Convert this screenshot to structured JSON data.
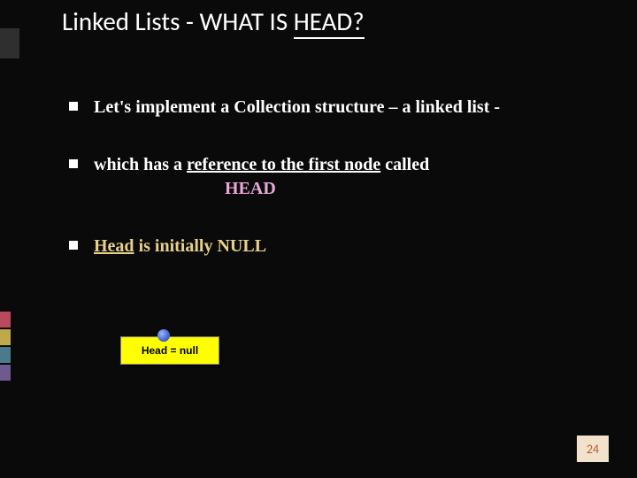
{
  "title": {
    "prefix": "Linked Lists  - WHAT IS ",
    "head": "HEAD?"
  },
  "bullets": {
    "b1": "Let's implement  a  Collection structure – a linked list  -",
    "b2": {
      "prefix": "which has a ",
      "ref": "reference to the first node",
      "suffix": " called",
      "head_label": "HEAD"
    },
    "b3": {
      "head": "Head",
      "rest": " is initially NULL"
    }
  },
  "head_null_box": "Head = null",
  "page_number": "24"
}
